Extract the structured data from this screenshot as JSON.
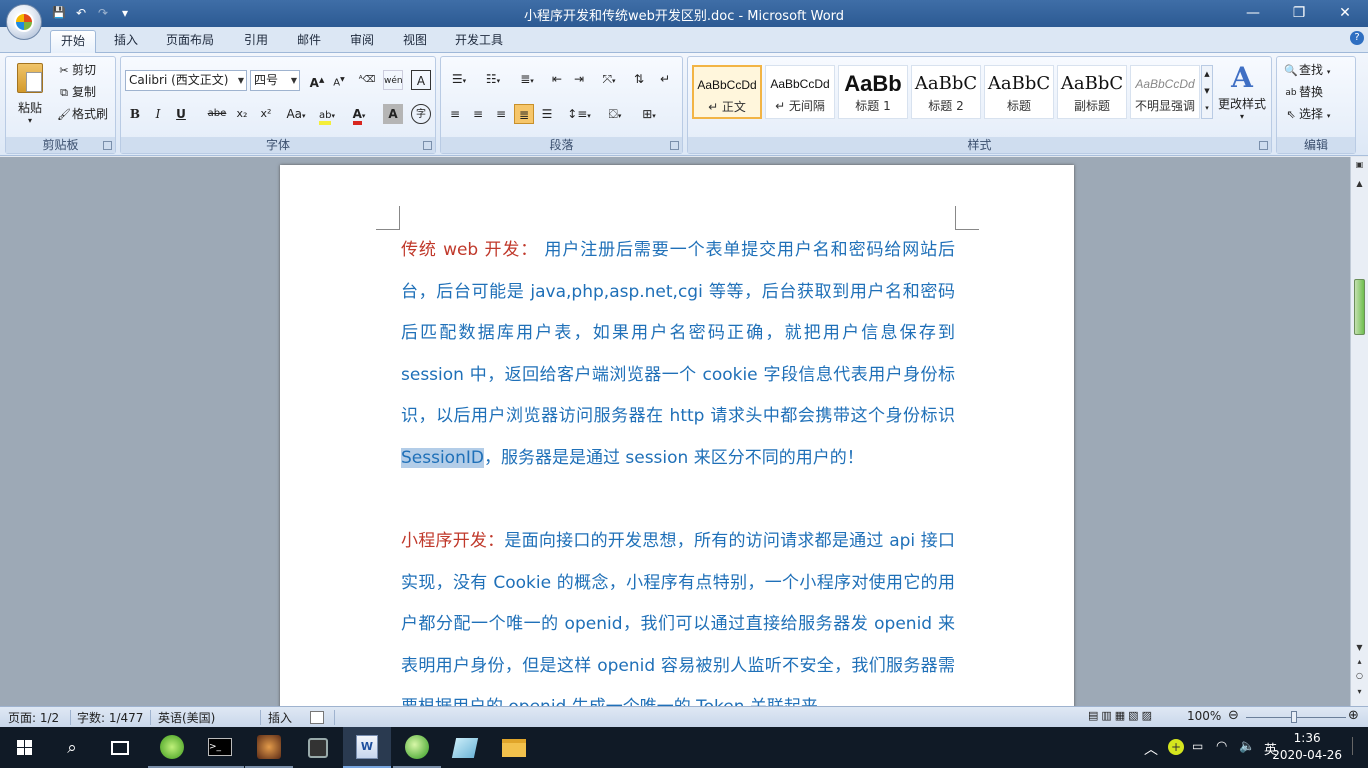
{
  "window": {
    "title": "小程序开发和传统web开发区别.doc - Microsoft Word",
    "controls": {
      "minimize": "—",
      "restore": "❐",
      "close": "✕"
    }
  },
  "qat": {
    "save": "💾",
    "undo": "↶",
    "redo": "↷",
    "customize": "▾"
  },
  "tabs": [
    "开始",
    "插入",
    "页面布局",
    "引用",
    "邮件",
    "审阅",
    "视图",
    "开发工具"
  ],
  "ribbon": {
    "clipboard": {
      "label": "剪贴板",
      "paste": "粘贴",
      "cut": "剪切",
      "copy": "复制",
      "format_painter": "格式刷"
    },
    "font": {
      "label": "字体",
      "font_name": "Calibri (西文正文)",
      "font_size": "四号",
      "bold": "B",
      "italic": "I",
      "underline": "U",
      "strike": "abe",
      "sub": "x₂",
      "sup": "x²",
      "case": "Aa",
      "grow": "A",
      "shrink": "A",
      "pinyin": "wén",
      "char_border": "A",
      "clear": "A",
      "enclose": "字"
    },
    "paragraph": {
      "label": "段落"
    },
    "styles": {
      "label": "样式",
      "items": [
        {
          "sample": "AaBbCcDd",
          "name": "↵ 正文"
        },
        {
          "sample": "AaBbCcDd",
          "name": "↵ 无间隔"
        },
        {
          "sample": "AaBb",
          "name": "标题 1"
        },
        {
          "sample": "AaBbC",
          "name": "标题 2"
        },
        {
          "sample": "AaBbC",
          "name": "标题"
        },
        {
          "sample": "AaBbC",
          "name": "副标题"
        },
        {
          "sample": "AaBbCcDd",
          "name": "不明显强调"
        }
      ],
      "change_styles": "更改样式"
    },
    "editing": {
      "label": "编辑",
      "find": "查找",
      "replace": "替换",
      "select": "选择"
    }
  },
  "document": {
    "para1": {
      "heading": "传统 web 开发：",
      "text1": "  用户注册后需要一个表单提交用户名和密码给网站后台，后台可能是 java,php,asp.net,cgi 等等，后台获取到用户名和密码后匹配数据库用户表，如果用户名密码正确，就把用户信息保存到 session 中，返回给客户端浏览器一个 cookie 字段信息代表用户身份标识，以后用户浏览器访问服务器在 http 请求头中都会携带这个身份标识 ",
      "highlight": "SessionID",
      "text2": "，服务器是是通过 session 来区分不同的用户的！"
    },
    "para2": {
      "heading": "小程序开发：",
      "text": "是面向接口的开发思想，所有的访问请求都是通过 api 接口实现，没有 Cookie 的概念，小程序有点特别，一个小程序对使用它的用户都分配一个唯一的 openid，我们可以通过直接给服务器发 openid 来表明用户身份，但是这样 openid 容易被别人监听不安全，我们服务器需要根据用户的 openid 生成一个唯一的 Token 关联起来"
    }
  },
  "statusbar": {
    "page": "页面: 1/2",
    "words": "字数: 1/477",
    "language": "英语(美国)",
    "mode": "插入",
    "zoom": "100%"
  },
  "taskbar": {
    "tray_lang": "英",
    "time": "1:36",
    "date": "2020-04-26"
  },
  "colors": {
    "heading": "#c0392b",
    "body_text": "#1f70b8",
    "selection": "#b3cde8"
  }
}
